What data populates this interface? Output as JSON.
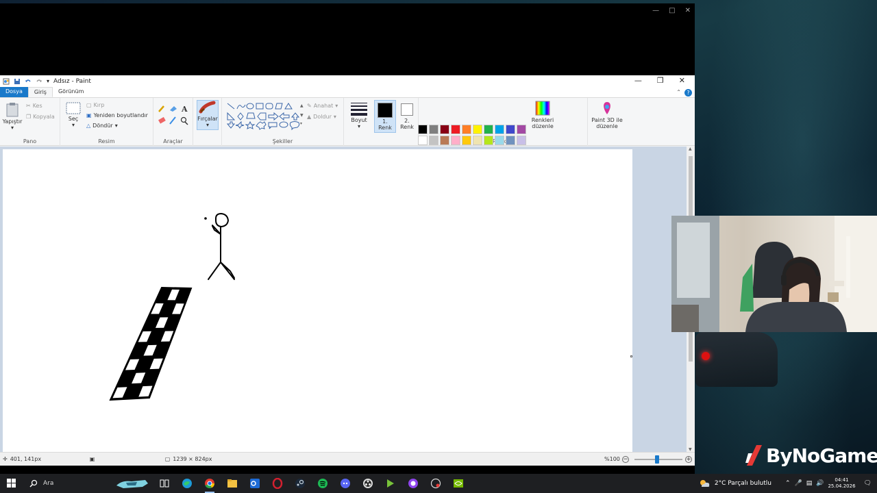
{
  "paint": {
    "title": "Adsız - Paint",
    "tabs": {
      "file": "Dosya",
      "home": "Giriş",
      "view": "Görünüm"
    },
    "clipboard": {
      "paste": "Yapıştır",
      "cut": "Kes",
      "copy": "Kopyala",
      "label": "Pano"
    },
    "image": {
      "select": "Seç",
      "crop": "Kırp",
      "resize": "Yeniden boyutlandır",
      "rotate": "Döndür",
      "label": "Resim"
    },
    "tools": {
      "label": "Araçlar"
    },
    "brushes": {
      "label": "Fırçalar"
    },
    "shapes": {
      "outline": "Anahat",
      "fill": "Doldur",
      "label": "Şekiller"
    },
    "size": {
      "label": "Boyut"
    },
    "color1": {
      "line1": "1.",
      "line2": "Renk",
      "value": "#000000"
    },
    "color2": {
      "line1": "2.",
      "line2": "Renk",
      "value": "#ffffff"
    },
    "colors": {
      "label": "Renkler",
      "edit_line1": "Renkleri",
      "edit_line2": "düzenle",
      "palette": [
        "#000000",
        "#7f7f7f",
        "#880015",
        "#ed1c24",
        "#ff7f27",
        "#fff200",
        "#22b14c",
        "#00a2e8",
        "#3f48cc",
        "#a349a4",
        "#ffffff",
        "#c3c3c3",
        "#b97a57",
        "#ffaec9",
        "#ffc90e",
        "#efe4b0",
        "#b5e61d",
        "#99d9ea",
        "#7092be",
        "#c8bfe7",
        "#ffffff",
        "#ffffff",
        "#ffffff",
        "#ffffff",
        "#ffffff",
        "#ffffff",
        "#ffffff",
        "#ffffff",
        "#ffffff",
        "#ffffff"
      ]
    },
    "paint3d": {
      "line1": "Paint 3D ile",
      "line2": "düzenle"
    },
    "status": {
      "cursor_pos": "401, 141px",
      "canvas_size": "1239 × 824px",
      "zoom": "%100"
    }
  },
  "taskbar": {
    "search_placeholder": "Ara",
    "weather": "2°C  Parçalı bulutlu",
    "time": "04:41",
    "date": "25.04.2026"
  },
  "overlay": {
    "brand": "ByNoGame"
  }
}
